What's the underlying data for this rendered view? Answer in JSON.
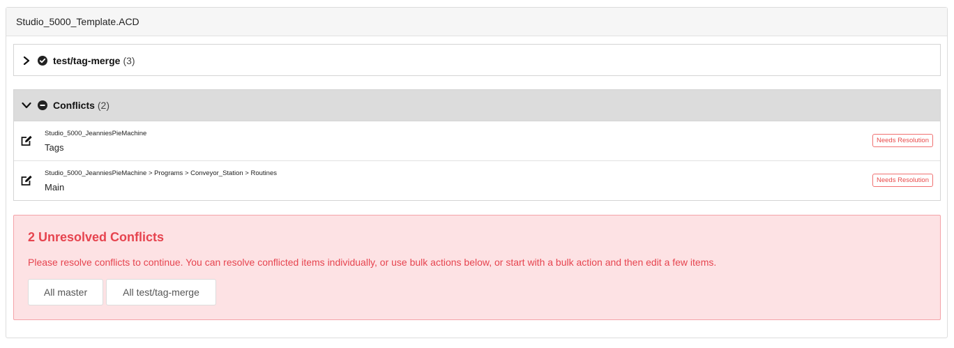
{
  "file": {
    "title": "Studio_5000_Template.ACD"
  },
  "branch": {
    "name": "test/tag-merge",
    "count": "(3)",
    "status_icon": "check-circle-icon"
  },
  "conflicts": {
    "label": "Conflicts",
    "count": "(2)",
    "status_icon": "minus-circle-icon",
    "items": [
      {
        "path": "Studio_5000_JeanniesPieMachine",
        "name": "Tags",
        "badge": "Needs Resolution"
      },
      {
        "path": "Studio_5000_JeanniesPieMachine > Programs > Conveyor_Station > Routines",
        "name": "Main",
        "badge": "Needs Resolution"
      }
    ]
  },
  "alert": {
    "title": "2 Unresolved Conflicts",
    "message": "Please resolve conflicts to continue. You can resolve conflicted items individually, or use bulk actions below, or start with a bulk action and then edit a few items.",
    "buttons": {
      "master": "All master",
      "branch": "All test/tag-merge"
    },
    "color": "#e6444f"
  }
}
